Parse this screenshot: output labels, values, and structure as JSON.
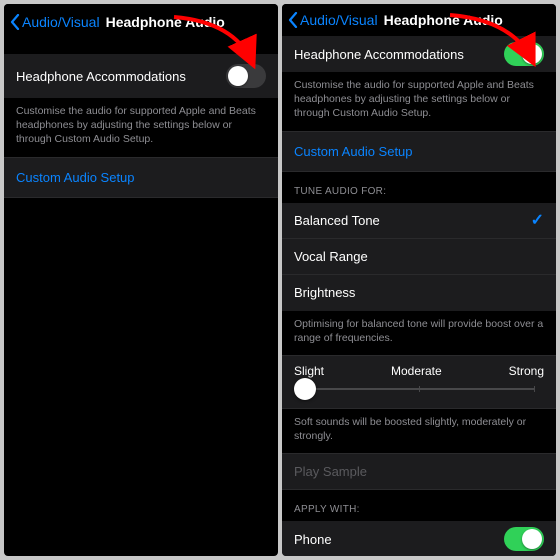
{
  "left": {
    "back_label": "Audio/Visual",
    "title": "Headphone Audio",
    "accommodations_label": "Headphone Accommodations",
    "accommodations_desc": "Customise the audio for supported Apple and Beats headphones by adjusting the settings below or through Custom Audio Setup.",
    "custom_setup_label": "Custom Audio Setup"
  },
  "right": {
    "back_label": "Audio/Visual",
    "title": "Headphone Audio",
    "accommodations_label": "Headphone Accommodations",
    "accommodations_desc": "Customise the audio for supported Apple and Beats headphones by adjusting the settings below or through Custom Audio Setup.",
    "custom_setup_label": "Custom Audio Setup",
    "tune_header": "TUNE AUDIO FOR:",
    "tune_options": {
      "balanced": "Balanced Tone",
      "vocal": "Vocal Range",
      "brightness": "Brightness"
    },
    "tune_desc": "Optimising for balanced tone will provide boost over a range of frequencies.",
    "slider": {
      "slight": "Slight",
      "moderate": "Moderate",
      "strong": "Strong"
    },
    "slider_desc": "Soft sounds will be boosted slightly, moderately or strongly.",
    "play_sample": "Play Sample",
    "apply_header": "APPLY WITH:",
    "apply_phone": "Phone"
  },
  "colors": {
    "accent": "#0a84ff",
    "toggle_on": "#30d158",
    "arrow": "#ff0000"
  }
}
